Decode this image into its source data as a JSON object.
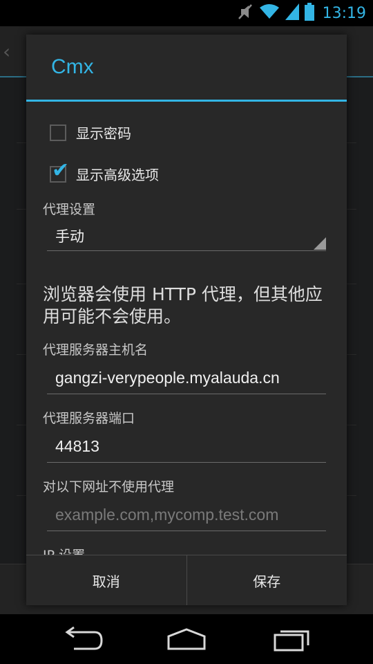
{
  "status_bar": {
    "time": "13:19",
    "icons": [
      "mute-icon",
      "wifi-icon",
      "signal-icon",
      "battery-icon"
    ]
  },
  "dialog": {
    "title": "Cmx",
    "show_password_label": "显示密码",
    "show_password_checked": false,
    "show_advanced_label": "显示高级选项",
    "show_advanced_checked": true,
    "proxy_settings_label": "代理设置",
    "proxy_mode_value": "手动",
    "proxy_info_text": "浏览器会使用 HTTP 代理，但其他应用可能不会使用。",
    "proxy_host_label": "代理服务器主机名",
    "proxy_host_value": "gangzi-verypeople.myalauda.cn",
    "proxy_port_label": "代理服务器端口",
    "proxy_port_value": "44813",
    "bypass_label": "对以下网址不使用代理",
    "bypass_placeholder": "example.com,mycomp.test.com",
    "ip_settings_label": "IP 设置",
    "cancel_label": "取消",
    "save_label": "保存"
  },
  "colors": {
    "accent": "#33b5e5",
    "dialog_bg": "#282828"
  },
  "nav_bar": {
    "icons": [
      "back-icon",
      "home-icon",
      "recents-icon"
    ]
  }
}
